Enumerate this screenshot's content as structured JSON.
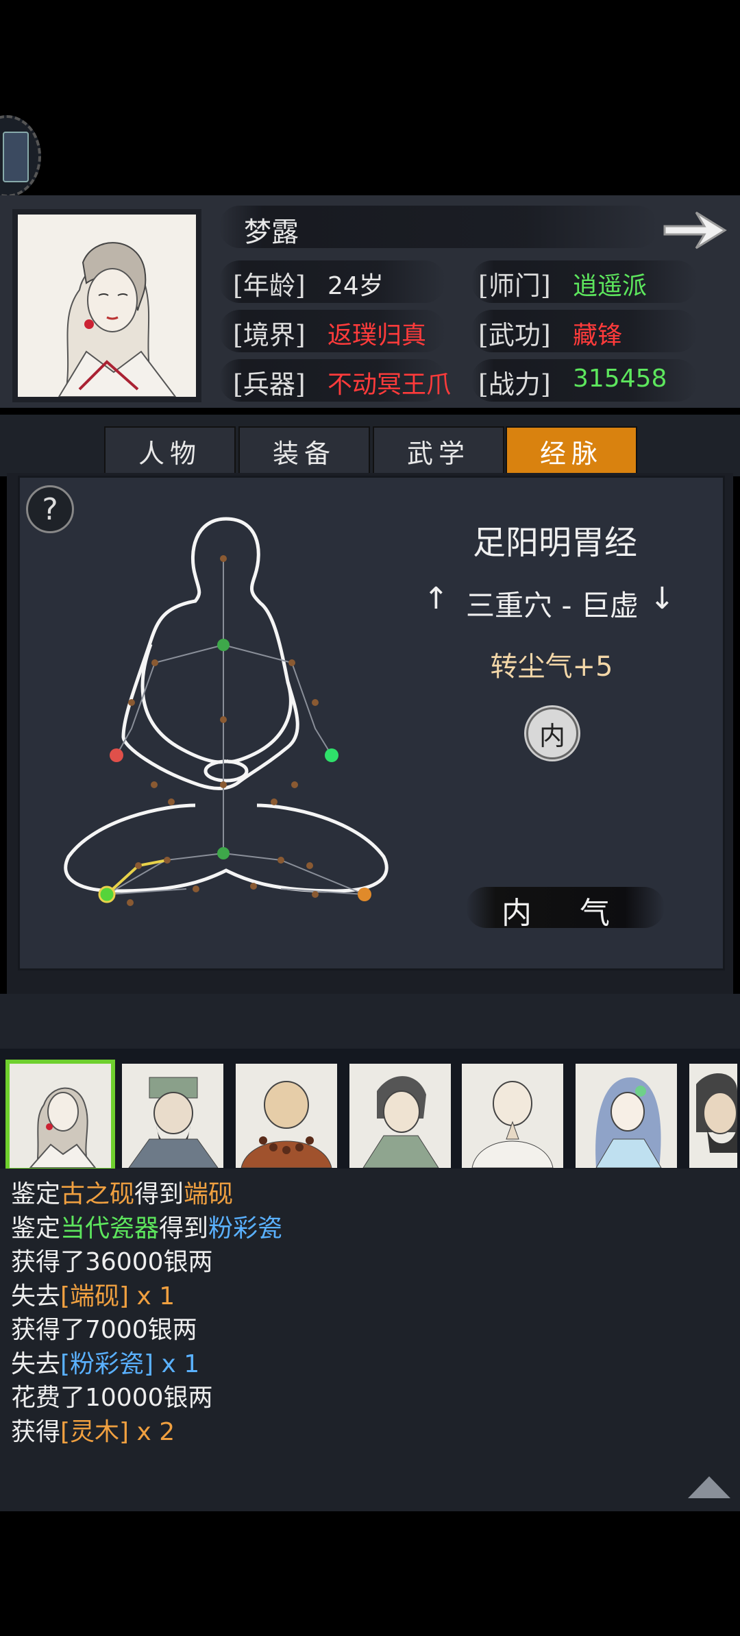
{
  "character": {
    "name": "梦露",
    "rows": [
      {
        "label": "[年龄]",
        "value": "24岁",
        "color": "#e8e8e8"
      },
      {
        "label": "[师门]",
        "value": "逍遥派",
        "color": "#5de65d"
      },
      {
        "label": "[境界]",
        "value": "返璞归真",
        "color": "#ff3b3b"
      },
      {
        "label": "[武功]",
        "value": "藏锋",
        "color": "#ff3b3b"
      },
      {
        "label": "[兵器]",
        "value": "不动冥王爪",
        "color": "#ff3b3b"
      },
      {
        "label": "[战力]",
        "value": "315458",
        "color": "#5de65d"
      }
    ]
  },
  "tabs": [
    {
      "label": "人物",
      "active": false
    },
    {
      "label": "装备",
      "active": false
    },
    {
      "label": "武学",
      "active": false
    },
    {
      "label": "经脉",
      "active": true
    }
  ],
  "meridian": {
    "title": "足阳明胃经",
    "acupoint": "三重穴 - 巨虚",
    "bonus": "转尘气+5",
    "badge": "内",
    "action": "内 气"
  },
  "log": [
    [
      {
        "t": "鉴定",
        "c": "w"
      },
      {
        "t": "古之砚",
        "c": "o"
      },
      {
        "t": "得到",
        "c": "w"
      },
      {
        "t": "端砚",
        "c": "o"
      }
    ],
    [
      {
        "t": "鉴定",
        "c": "w"
      },
      {
        "t": "当代瓷器",
        "c": "g"
      },
      {
        "t": "得到",
        "c": "w"
      },
      {
        "t": "粉彩瓷",
        "c": "b"
      }
    ],
    [
      {
        "t": "获得了36000银两",
        "c": "w"
      }
    ],
    [
      {
        "t": "失去",
        "c": "w"
      },
      {
        "t": "[端砚] x 1",
        "c": "o"
      }
    ],
    [
      {
        "t": "获得了7000银两",
        "c": "w"
      }
    ],
    [
      {
        "t": "失去",
        "c": "w"
      },
      {
        "t": "[粉彩瓷] x 1",
        "c": "b"
      }
    ],
    [
      {
        "t": "花费了10000银两",
        "c": "w"
      }
    ],
    [
      {
        "t": "获得",
        "c": "w"
      },
      {
        "t": "[灵木] x 2",
        "c": "o"
      }
    ]
  ],
  "icons": {
    "next": "right-arrow-icon",
    "help": "question-mark-icon",
    "up": "acupoint-up-arrow-icon",
    "down": "acupoint-down-arrow-icon",
    "scroll_top": "triangle-up-icon"
  },
  "help_glyph": "?",
  "arrows": {
    "up": "↑",
    "down": "↓"
  }
}
